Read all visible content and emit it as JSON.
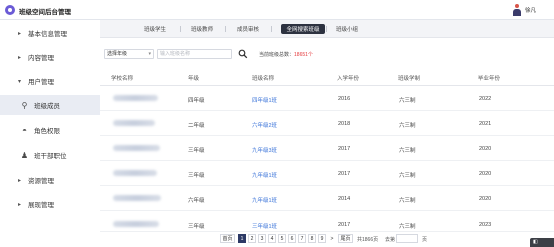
{
  "app": {
    "title": "班级空间后台管理",
    "user_name": "徐凡"
  },
  "sidebar": {
    "items": [
      {
        "label": "基本信息管理",
        "icon": "chevron-right-icon",
        "glyph": "▸"
      },
      {
        "label": "内容管理",
        "icon": "chevron-right-icon",
        "glyph": "▸"
      },
      {
        "label": "用户管理",
        "icon": "chevron-down-icon",
        "glyph": "▾"
      },
      {
        "label": "班级成员",
        "icon": "user-icon",
        "glyph": "⚲"
      },
      {
        "label": "角色权限",
        "icon": "role-icon",
        "glyph": "◓"
      },
      {
        "label": "班干部职位",
        "icon": "org-icon",
        "glyph": "♟"
      },
      {
        "label": "资源管理",
        "icon": "chevron-right-icon",
        "glyph": "▸"
      },
      {
        "label": "展现管理",
        "icon": "chevron-right-icon",
        "glyph": "▸"
      }
    ]
  },
  "tabs": [
    "班级学生",
    "班级教师",
    "成员审核",
    "全网搜索班级",
    "班级小组"
  ],
  "active_tab": 3,
  "filters": {
    "grade_select": "选择年级",
    "search_placeholder": "输入班级名称",
    "count_label": "当前班级总数：",
    "count_value": "18651个"
  },
  "table": {
    "headers": [
      "学校名称",
      "年级",
      "班级名称",
      "入学年份",
      "班级学制",
      "毕业年份"
    ],
    "rows": [
      {
        "grade": "四年级",
        "class": "四年级1班",
        "year": "2016",
        "system": "六三制",
        "grad": "2022"
      },
      {
        "grade": "二年级",
        "class": "六年级2班",
        "year": "2018",
        "system": "六三制",
        "grad": "2021"
      },
      {
        "grade": "三年级",
        "class": "九年级3班",
        "year": "2017",
        "system": "六三制",
        "grad": "2020"
      },
      {
        "grade": "三年级",
        "class": "九年级1班",
        "year": "2017",
        "system": "六三制",
        "grad": "2020"
      },
      {
        "grade": "六年级",
        "class": "九年级1班",
        "year": "2014",
        "system": "六三制",
        "grad": "2020"
      },
      {
        "grade": "三年级",
        "class": "三年级1班",
        "year": "2017",
        "system": "六三制",
        "grad": "2023"
      }
    ]
  },
  "pager": {
    "first": "首页",
    "pages": [
      "1",
      "2",
      "3",
      "4",
      "5",
      "6",
      "7",
      "8",
      "9"
    ],
    "active_page": "1",
    "next": ">",
    "last": "尾页",
    "total": "共1866页",
    "goto": "去第",
    "page_unit": "页"
  },
  "colors": {
    "accent": "#2d3a66",
    "link": "#3a73d9",
    "count": "#e4393c"
  }
}
